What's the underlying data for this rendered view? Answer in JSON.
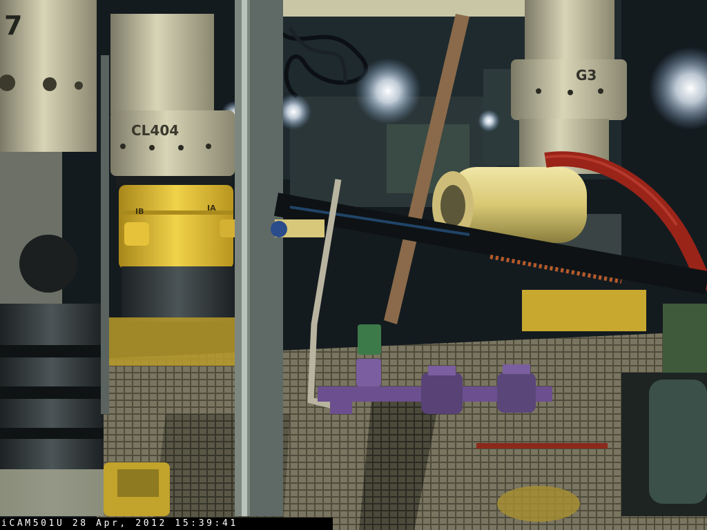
{
  "overlay": {
    "camera_id": "iCAM501U",
    "date": "28 Apr, 2012",
    "time": "15:39:41"
  },
  "markings": {
    "left_column_stencil": "CL404",
    "right_column_stencil": "G3",
    "yellow_port_left": "IB",
    "yellow_port_right": "IA",
    "far_left_stencil": "7"
  },
  "colors": {
    "steel": "#8f9a92",
    "grime_white": "#d9d6b8",
    "safety_yellow": "#e8c531",
    "hose_red": "#9a2418",
    "valve_purple": "#6c4f8e",
    "deck_grate": "#6e6a55",
    "light_glow": "#ffffff"
  }
}
